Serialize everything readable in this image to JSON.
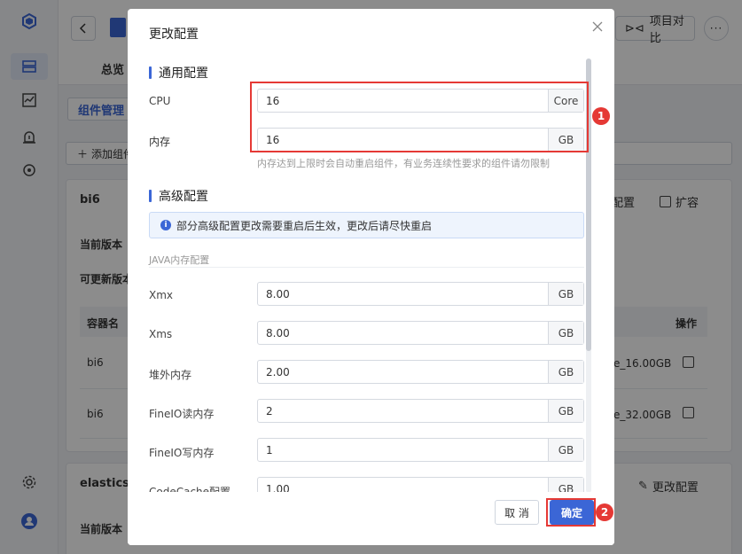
{
  "background": {
    "compare_label": "项目对比",
    "more_label": "···",
    "tab_overview": "总览",
    "component_tab": "组件管理",
    "add_component": "添加组件",
    "card1": {
      "name": "bi6",
      "current_version_label": "当前版本",
      "updatable_version_label": "可更新版本",
      "col_container": "容器名",
      "col_action": "操作",
      "rows": [
        {
          "name": "bi6",
          "spec": "e_16.00GB"
        },
        {
          "name": "bi6",
          "spec": "e_32.00GB"
        }
      ],
      "action_config": "配置",
      "action_scale": "扩容"
    },
    "card2": {
      "name": "elasticse",
      "current_version_label": "当前版本",
      "action_config": "更改配置"
    }
  },
  "modal": {
    "title": "更改配置",
    "general_section": "通用配置",
    "cpu": {
      "label": "CPU",
      "value": "16",
      "unit": "Core"
    },
    "memory": {
      "label": "内存",
      "value": "16",
      "unit": "GB"
    },
    "memory_hint": "内存达到上限时会自动重启组件，有业务连续性要求的组件请勿限制",
    "advanced_section": "高级配置",
    "advanced_notice": "部分高级配置更改需要重启后生效，更改后请尽快重启",
    "java_section": "JAVA内存配置",
    "fields": [
      {
        "label": "Xmx",
        "value": "8.00",
        "unit": "GB"
      },
      {
        "label": "Xms",
        "value": "8.00",
        "unit": "GB"
      },
      {
        "label": "堆外内存",
        "value": "2.00",
        "unit": "GB"
      },
      {
        "label": "FineIO读内存",
        "value": "2",
        "unit": "GB"
      },
      {
        "label": "FineIO写内存",
        "value": "1",
        "unit": "GB"
      },
      {
        "label": "CodeCache配置",
        "value": "1.00",
        "unit": "GB"
      }
    ],
    "cancel_label": "取 消",
    "ok_label": "确定"
  },
  "annotations": {
    "badge1": "1",
    "badge2": "2"
  },
  "colors": {
    "accent": "#3b66d6",
    "highlight": "#e53935"
  }
}
